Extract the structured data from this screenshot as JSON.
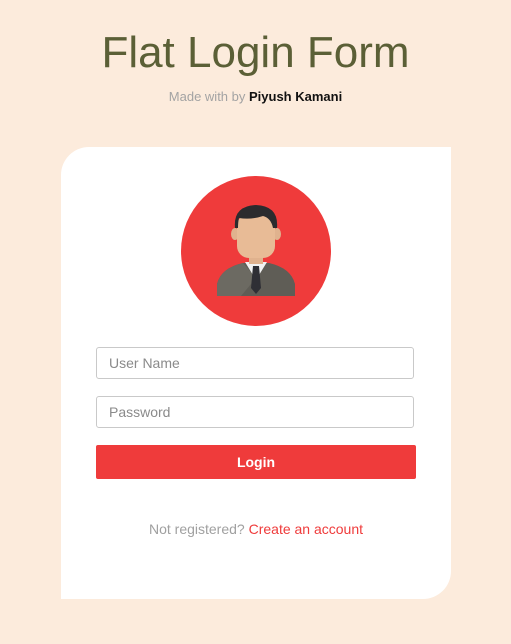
{
  "header": {
    "title": "Flat Login Form",
    "credit_prefix": "Made with by",
    "credit_author": "Piyush Kamani"
  },
  "form": {
    "avatar_icon": "user-avatar-icon",
    "username_placeholder": "User Name",
    "username_value": "",
    "password_placeholder": "Password",
    "password_value": "",
    "login_label": "Login",
    "register_prompt": "Not registered?",
    "register_link": "Create an account"
  },
  "colors": {
    "background": "#fcebdc",
    "accent": "#ef3b3b",
    "title": "#5b5f36"
  }
}
